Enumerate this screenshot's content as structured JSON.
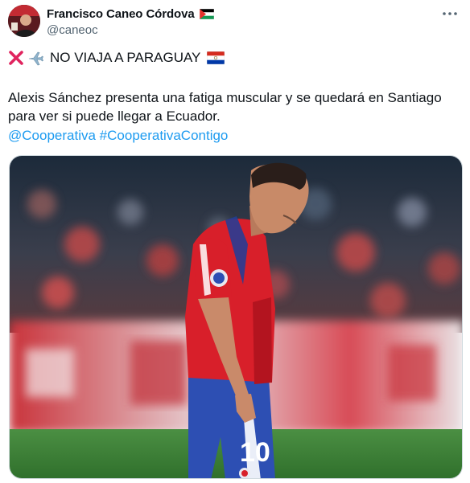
{
  "author": {
    "display_name": "Francisco Caneo Córdova",
    "handle": "@caneoc",
    "flag_icon": "palestine-flag-icon"
  },
  "tweet": {
    "headline_icons": [
      "cross-mark-icon",
      "airplane-icon"
    ],
    "headline_text": "NO VIAJA A PARAGUAY",
    "headline_flag": "paraguay-flag-icon",
    "body": "Alexis Sánchez presenta una fatiga muscular y se quedará en Santiago para ver si puede llegar a Ecuador.",
    "hashtags": [
      "@Cooperativa",
      "#CooperativaContigo"
    ]
  },
  "media": {
    "jersey_number": "10"
  },
  "colors": {
    "link": "#1d9bf0",
    "text": "#0f1419",
    "secondary": "#536471",
    "jersey_red": "#d81f2a",
    "shorts_blue": "#2d4fb3",
    "pitch_green": "#3f8a3a"
  }
}
